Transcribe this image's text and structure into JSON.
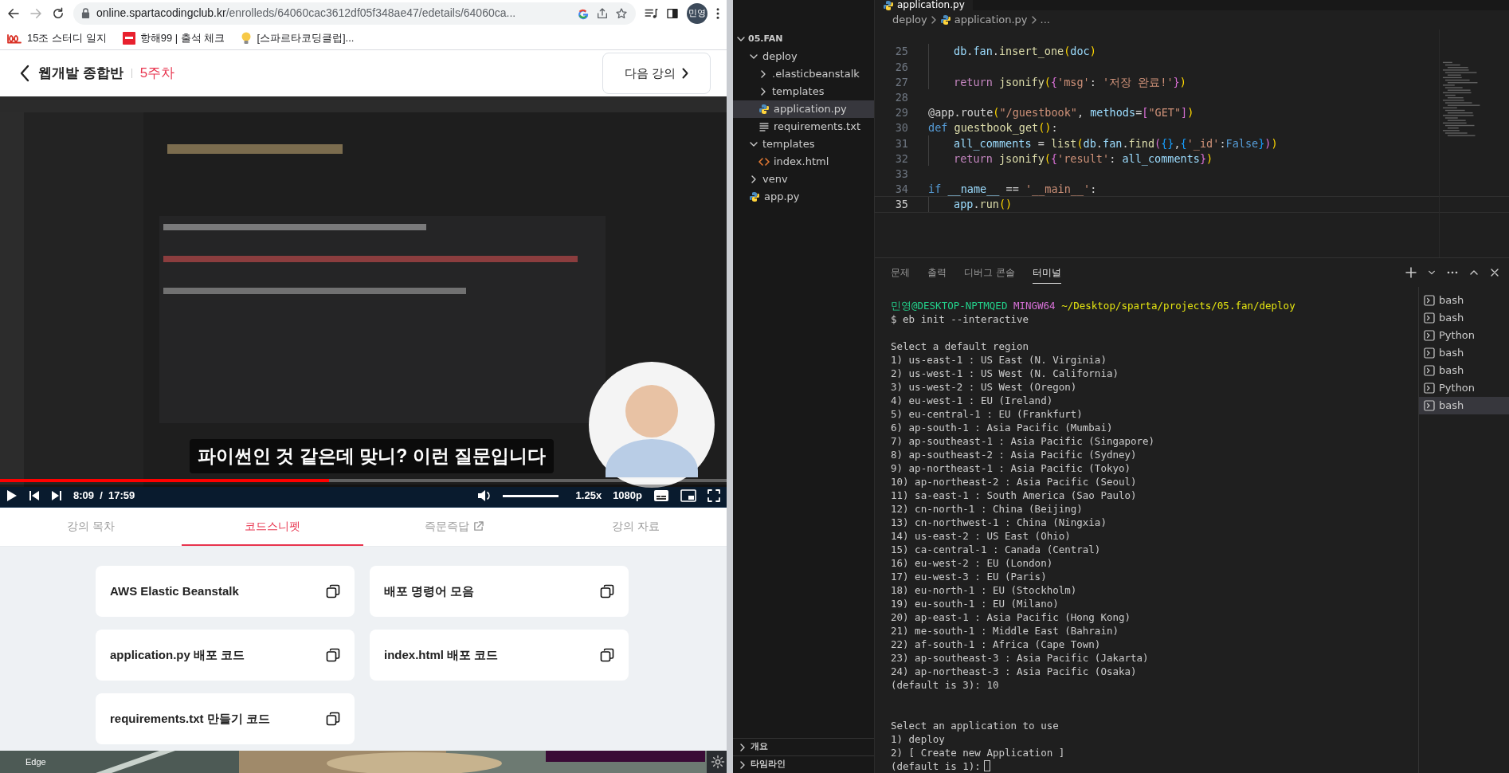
{
  "browser": {
    "url_host": "online.spartacodingclub.kr",
    "url_path": "/enrolleds/64060cac3612df05f348ae47/edetails/64060ca...",
    "profile": "민영",
    "forward_disabled": true
  },
  "bookmarks": [
    {
      "label": "15조 스터디 일지",
      "kind": "hundred"
    },
    {
      "label": "항해99 | 출석 체크",
      "kind": "tile"
    },
    {
      "label": "[스파르타코딩클럽]...",
      "kind": "bulb"
    }
  ],
  "course_header": {
    "title": "웹개발 종합반",
    "week": "5주차",
    "next_button": "다음 강의"
  },
  "video": {
    "caption": "파이썬인 것 같은데 맞니? 이런 질문입니다",
    "progress": {
      "level": 0.453
    },
    "current_time": "8:09",
    "separator": "/",
    "duration": "17:59",
    "volume": {
      "level": 1
    },
    "speed": "1.25x",
    "quality": "1080p"
  },
  "lecture_tabs": [
    {
      "label": "강의 목차",
      "selected": false,
      "external": false
    },
    {
      "label": "코드스니펫",
      "selected": true,
      "external": false
    },
    {
      "label": "즉문즉답",
      "selected": false,
      "external": true
    },
    {
      "label": "강의 자료",
      "selected": false,
      "external": false
    }
  ],
  "snippets": [
    "AWS Elastic Beanstalk",
    "배포 명령어 모음",
    "application.py 배포 코드",
    "index.html 배포 코드",
    "requirements.txt 만들기 코드"
  ],
  "desktop": {
    "icon_label": "Edge"
  },
  "editor": {
    "tab": "application.py",
    "breadcrumb": [
      "deploy",
      "application.py",
      "..."
    ],
    "explorer": {
      "root": "05.FAN",
      "items": [
        {
          "label": "deploy",
          "kind": "folder",
          "expanded": true,
          "selected": false,
          "children": [
            {
              "label": ".elasticbeanstalk",
              "kind": "folder",
              "expanded": false,
              "selected": false
            },
            {
              "label": "templates",
              "kind": "folder",
              "expanded": false,
              "selected": false
            },
            {
              "label": "application.py",
              "kind": "python",
              "selected": true
            },
            {
              "label": "requirements.txt",
              "kind": "text",
              "selected": false
            }
          ]
        },
        {
          "label": "templates",
          "kind": "folder",
          "expanded": true,
          "selected": false,
          "children": [
            {
              "label": "index.html",
              "kind": "html",
              "selected": false
            }
          ]
        },
        {
          "label": "venv",
          "kind": "folder",
          "expanded": false,
          "selected": false
        },
        {
          "label": "app.py",
          "kind": "python",
          "selected": false
        }
      ]
    },
    "sections": [
      {
        "label": "개요",
        "expanded": false
      },
      {
        "label": "타임라인",
        "expanded": false
      }
    ],
    "lines": [
      {
        "number": "25",
        "current": false,
        "indented": true,
        "tokens": [
          {
            "text": "db",
            "kind": "var"
          },
          {
            "text": ".",
            "kind": "op"
          },
          {
            "text": "fan",
            "kind": "var"
          },
          {
            "text": ".",
            "kind": "op"
          },
          {
            "text": "insert_one",
            "kind": "fn"
          },
          {
            "text": "(",
            "kind": "b1"
          },
          {
            "text": "doc",
            "kind": "var"
          },
          {
            "text": ")",
            "kind": "b1"
          }
        ]
      },
      {
        "number": "26",
        "current": false,
        "indented": true
      },
      {
        "number": "27",
        "current": false,
        "indented": true,
        "tokens": [
          {
            "text": "return ",
            "kind": "kw"
          },
          {
            "text": "jsonify",
            "kind": "fn"
          },
          {
            "text": "(",
            "kind": "b1"
          },
          {
            "text": "{",
            "kind": "b2"
          },
          {
            "text": "'msg'",
            "kind": "str"
          },
          {
            "text": ": ",
            "kind": "op"
          },
          {
            "text": "'저장 완료!'",
            "kind": "str"
          },
          {
            "text": "}",
            "kind": "b2"
          },
          {
            "text": ")",
            "kind": "b1"
          }
        ]
      },
      {
        "number": "28",
        "current": false,
        "indented": false
      },
      {
        "number": "29",
        "current": false,
        "indented": false,
        "tokens": [
          {
            "text": "@app.route",
            "kind": "op"
          },
          {
            "text": "(",
            "kind": "b1"
          },
          {
            "text": "\"/guestbook\"",
            "kind": "str"
          },
          {
            "text": ", ",
            "kind": "op"
          },
          {
            "text": "methods",
            "kind": "var"
          },
          {
            "text": "=",
            "kind": "op"
          },
          {
            "text": "[",
            "kind": "b2"
          },
          {
            "text": "\"GET\"",
            "kind": "str"
          },
          {
            "text": "]",
            "kind": "b2"
          },
          {
            "text": ")",
            "kind": "b1"
          }
        ]
      },
      {
        "number": "30",
        "current": false,
        "indented": false,
        "tokens": [
          {
            "text": "def ",
            "kind": "storage"
          },
          {
            "text": "guestbook_get",
            "kind": "fn"
          },
          {
            "text": "()",
            "kind": "b1"
          },
          {
            "text": ":",
            "kind": "op"
          }
        ]
      },
      {
        "number": "31",
        "current": false,
        "indented": true,
        "tokens": [
          {
            "text": "all_comments",
            "kind": "var"
          },
          {
            "text": " = ",
            "kind": "op"
          },
          {
            "text": "list",
            "kind": "fn"
          },
          {
            "text": "(",
            "kind": "b1"
          },
          {
            "text": "db",
            "kind": "var"
          },
          {
            "text": ".",
            "kind": "op"
          },
          {
            "text": "fan",
            "kind": "var"
          },
          {
            "text": ".",
            "kind": "op"
          },
          {
            "text": "find",
            "kind": "fn"
          },
          {
            "text": "(",
            "kind": "b2"
          },
          {
            "text": "{}",
            "kind": "b3"
          },
          {
            "text": ",",
            "kind": "op"
          },
          {
            "text": "{",
            "kind": "b3"
          },
          {
            "text": "'_id'",
            "kind": "str"
          },
          {
            "text": ":",
            "kind": "op"
          },
          {
            "text": "False",
            "kind": "const"
          },
          {
            "text": "}",
            "kind": "b3"
          },
          {
            "text": ")",
            "kind": "b2"
          },
          {
            "text": ")",
            "kind": "b1"
          }
        ]
      },
      {
        "number": "32",
        "current": false,
        "indented": true,
        "tokens": [
          {
            "text": "return ",
            "kind": "kw"
          },
          {
            "text": "jsonify",
            "kind": "fn"
          },
          {
            "text": "(",
            "kind": "b1"
          },
          {
            "text": "{",
            "kind": "b2"
          },
          {
            "text": "'result'",
            "kind": "str"
          },
          {
            "text": ": ",
            "kind": "op"
          },
          {
            "text": "all_comments",
            "kind": "var"
          },
          {
            "text": "}",
            "kind": "b2"
          },
          {
            "text": ")",
            "kind": "b1"
          }
        ]
      },
      {
        "number": "33",
        "current": false,
        "indented": false
      },
      {
        "number": "34",
        "current": false,
        "indented": false,
        "tokens": [
          {
            "text": "if ",
            "kind": "storage"
          },
          {
            "text": "__name__",
            "kind": "var"
          },
          {
            "text": " == ",
            "kind": "op"
          },
          {
            "text": "'__main__'",
            "kind": "str"
          },
          {
            "text": ":",
            "kind": "op"
          }
        ]
      },
      {
        "number": "35",
        "current": true,
        "indented": true,
        "tokens": [
          {
            "text": "app",
            "kind": "var"
          },
          {
            "text": ".",
            "kind": "op"
          },
          {
            "text": "run",
            "kind": "fn"
          },
          {
            "text": "()",
            "kind": "b1"
          }
        ]
      }
    ]
  },
  "panel": {
    "tabs": [
      {
        "label": "문제",
        "selected": false
      },
      {
        "label": "출력",
        "selected": false
      },
      {
        "label": "디버그 콘솔",
        "selected": false
      },
      {
        "label": "터미널",
        "selected": true
      }
    ],
    "prompt": {
      "user": "민영@DESKTOP-NPTMQED",
      "system": "MINGW64",
      "path": "~/Desktop/sparta/projects/05.fan/deploy"
    },
    "blocks": [
      [
        "$ eb init --interactive"
      ],
      [
        "Select a default region",
        "1) us-east-1 : US East (N. Virginia)",
        "2) us-west-1 : US West (N. California)",
        "3) us-west-2 : US West (Oregon)",
        "4) eu-west-1 : EU (Ireland)",
        "5) eu-central-1 : EU (Frankfurt)",
        "6) ap-south-1 : Asia Pacific (Mumbai)",
        "7) ap-southeast-1 : Asia Pacific (Singapore)",
        "8) ap-southeast-2 : Asia Pacific (Sydney)",
        "9) ap-northeast-1 : Asia Pacific (Tokyo)",
        "10) ap-northeast-2 : Asia Pacific (Seoul)",
        "11) sa-east-1 : South America (Sao Paulo)",
        "12) cn-north-1 : China (Beijing)",
        "13) cn-northwest-1 : China (Ningxia)",
        "14) us-east-2 : US East (Ohio)",
        "15) ca-central-1 : Canada (Central)",
        "16) eu-west-2 : EU (London)",
        "17) eu-west-3 : EU (Paris)",
        "18) eu-north-1 : EU (Stockholm)",
        "19) eu-south-1 : EU (Milano)",
        "20) ap-east-1 : Asia Pacific (Hong Kong)",
        "21) me-south-1 : Middle East (Bahrain)",
        "22) af-south-1 : Africa (Cape Town)",
        "23) ap-southeast-3 : Asia Pacific (Jakarta)",
        "24) ap-northeast-3 : Asia Pacific (Osaka)",
        "(default is 3): 10"
      ],
      [
        "Select an application to use",
        "1) deploy",
        "2) [ Create new Application ]",
        "(default is 1):"
      ]
    ],
    "terminals": [
      {
        "label": "bash",
        "selected": false
      },
      {
        "label": "bash",
        "selected": false
      },
      {
        "label": "Python",
        "selected": false
      },
      {
        "label": "bash",
        "selected": false
      },
      {
        "label": "bash",
        "selected": false
      },
      {
        "label": "Python",
        "selected": false
      },
      {
        "label": "bash",
        "selected": true
      }
    ]
  }
}
